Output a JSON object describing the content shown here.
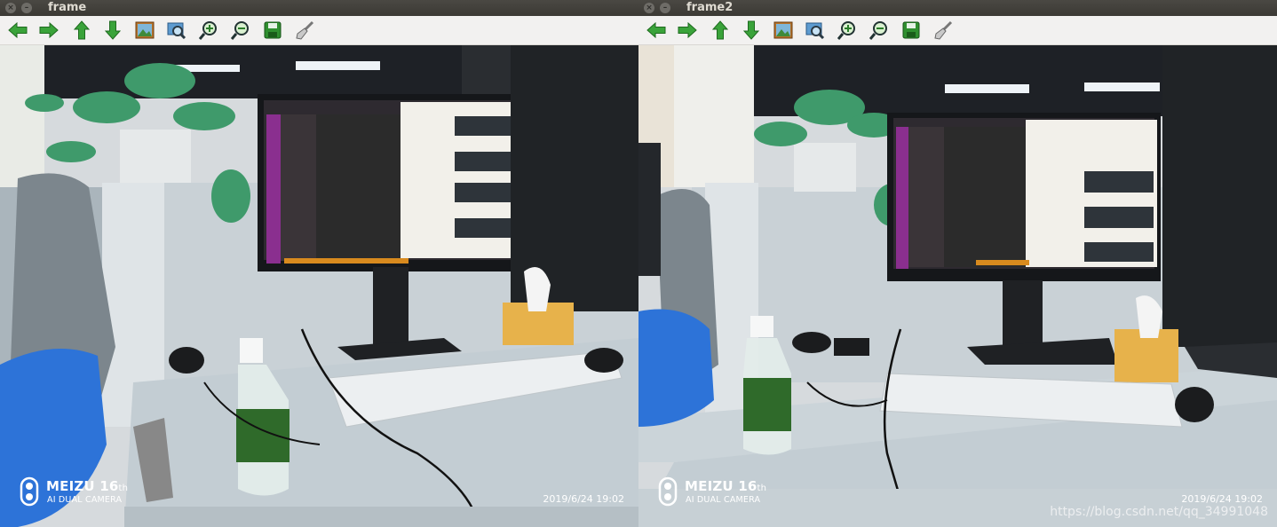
{
  "windows": [
    {
      "title": "frame",
      "watermark": {
        "brand": "MEIZU 16",
        "brand_suffix": "th",
        "subtitle": "AI DUAL CAMERA",
        "datetime": "2019/6/24  19:02"
      }
    },
    {
      "title": "frame2",
      "watermark": {
        "brand": "MEIZU 16",
        "brand_suffix": "th",
        "subtitle": "AI DUAL CAMERA",
        "datetime": "2019/6/24  19:02"
      }
    }
  ],
  "toolbar_icons": [
    "arrow-left-icon",
    "arrow-right-icon",
    "arrow-up-icon",
    "arrow-down-icon",
    "image-icon",
    "zoom-fit-icon",
    "zoom-in-icon",
    "zoom-out-icon",
    "save-icon",
    "brush-icon"
  ],
  "footer_url": "https://blog.csdn.net/qq_34991048",
  "colors": {
    "titlebar": "#3b3934",
    "toolbar": "#f2f1f0",
    "arrow": "#3aa33a",
    "desk": "#c9d3d9",
    "monitor": "#1b1d1f"
  }
}
